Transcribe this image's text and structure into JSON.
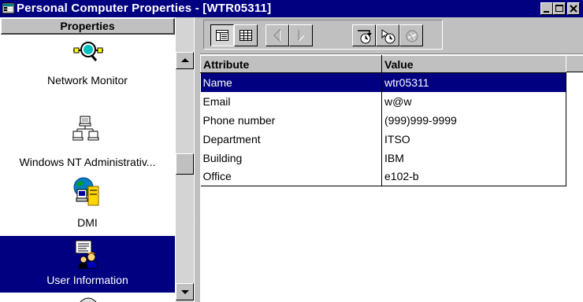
{
  "window": {
    "title": "Personal Computer Properties - [WTR05311]",
    "app_icon": "properties-icon",
    "controls": [
      "minimize-icon",
      "maximize-icon",
      "close-icon"
    ]
  },
  "sidebar": {
    "header": "Properties",
    "items": [
      {
        "label": "Network Monitor",
        "icon": "network-monitor-icon",
        "selected": false
      },
      {
        "label": "Windows NT Administrativ...",
        "icon": "nt-admin-icon",
        "selected": false
      },
      {
        "label": "DMI",
        "icon": "dmi-icon",
        "selected": false
      },
      {
        "label": "User Information",
        "icon": "user-information-icon",
        "selected": true
      }
    ]
  },
  "toolbar": {
    "buttons": [
      {
        "icon": "detail-view-icon",
        "state": "pressed"
      },
      {
        "icon": "grid-view-icon",
        "state": "normal"
      },
      {
        "icon": "previous-icon",
        "state": "disabled"
      },
      {
        "icon": "next-icon",
        "state": "disabled"
      },
      {
        "icon": "refresh-history-icon",
        "state": "normal"
      },
      {
        "icon": "refresh-selected-icon",
        "state": "normal"
      },
      {
        "icon": "stop-refresh-icon",
        "state": "disabled"
      }
    ]
  },
  "grid": {
    "headers": {
      "attribute": "Attribute",
      "value": "Value"
    },
    "rows": [
      {
        "attribute": "Name",
        "value": "wtr05311",
        "selected": true
      },
      {
        "attribute": "Email",
        "value": "w@w",
        "selected": false
      },
      {
        "attribute": "Phone number",
        "value": "(999)999-9999",
        "selected": false
      },
      {
        "attribute": "Department",
        "value": "ITSO",
        "selected": false
      },
      {
        "attribute": "Building",
        "value": "IBM",
        "selected": false
      },
      {
        "attribute": "Office",
        "value": "e102-b",
        "selected": false
      }
    ]
  },
  "colors": {
    "selection": "#000080",
    "face": "#c0c0c0"
  }
}
